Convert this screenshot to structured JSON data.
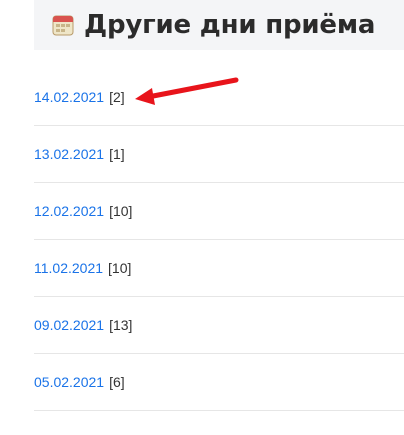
{
  "header": {
    "title": "Другие дни приёма",
    "icon": "calendar-icon"
  },
  "days": [
    {
      "date": "14.02.2021",
      "count": "[2]"
    },
    {
      "date": "13.02.2021",
      "count": "[1]"
    },
    {
      "date": "12.02.2021",
      "count": "[10]"
    },
    {
      "date": "11.02.2021",
      "count": "[10]"
    },
    {
      "date": "09.02.2021",
      "count": "[13]"
    },
    {
      "date": "05.02.2021",
      "count": "[6]"
    }
  ],
  "annotation": {
    "type": "red-arrow",
    "color": "#e8141b"
  },
  "colors": {
    "link": "#1a73e8",
    "header_bg": "#f4f5f7",
    "divider": "#e6e6e6"
  }
}
